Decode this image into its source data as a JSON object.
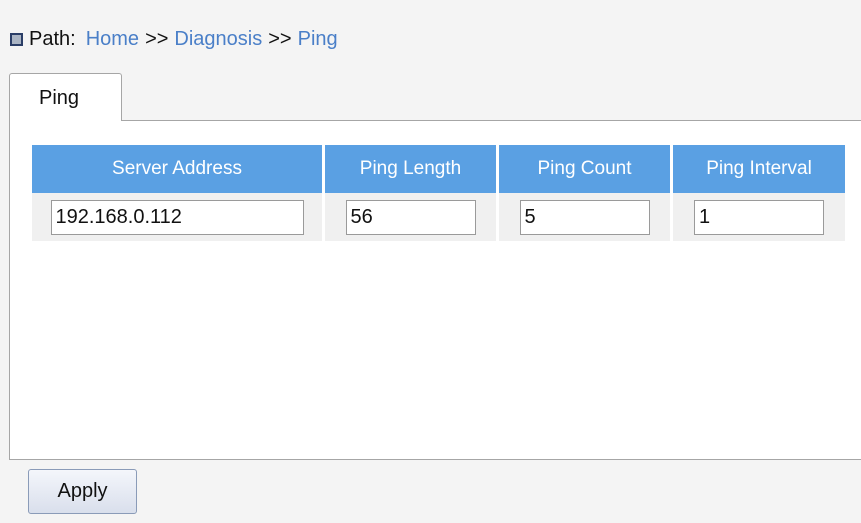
{
  "breadcrumb": {
    "label": "Path:",
    "items": [
      "Home",
      "Diagnosis",
      "Ping"
    ],
    "separator": ">>"
  },
  "tab": {
    "label": "Ping"
  },
  "table": {
    "headers": [
      "Server Address",
      "Ping Length",
      "Ping Count",
      "Ping Interval"
    ],
    "values": {
      "server_address": "192.168.0.112",
      "ping_length": "56",
      "ping_count": "5",
      "ping_interval": "1"
    }
  },
  "apply_label": "Apply",
  "colors": {
    "header_bg": "#5aa0e3",
    "link": "#4a7fc8",
    "page_bg": "#f4f4f4"
  }
}
